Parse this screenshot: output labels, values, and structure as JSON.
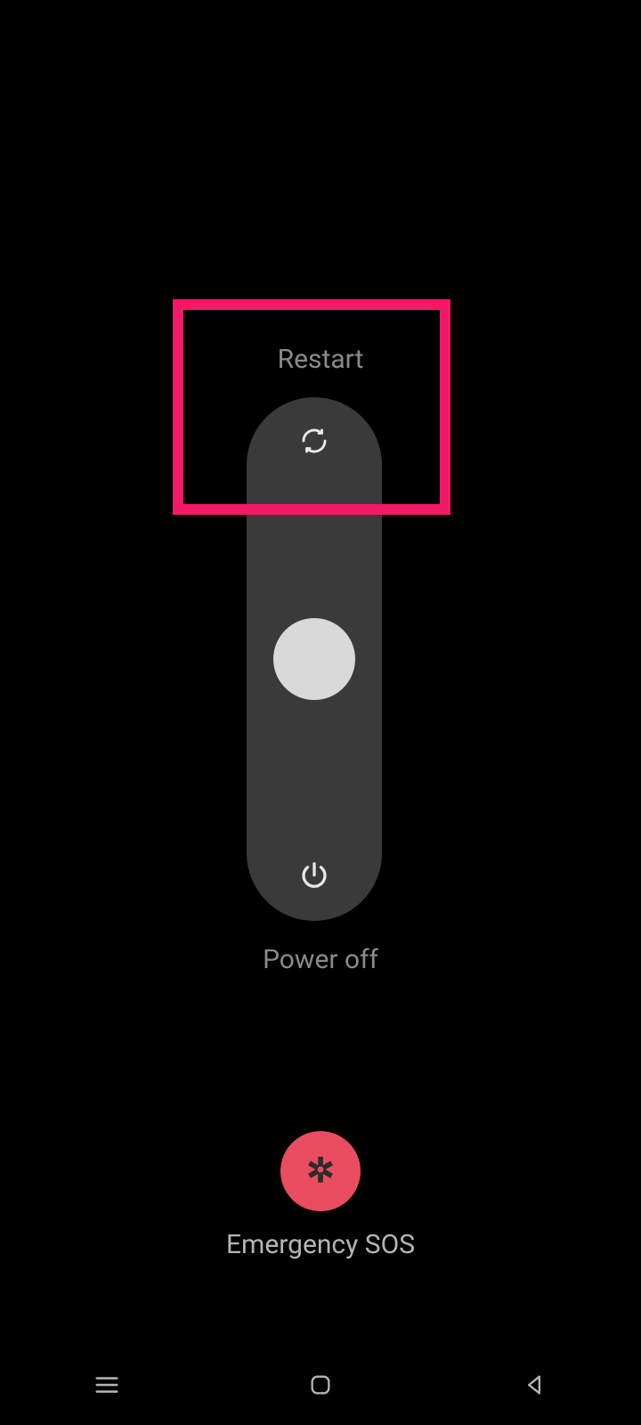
{
  "power_menu": {
    "restart_label": "Restart",
    "power_off_label": "Power off",
    "emergency_label": "Emergency SOS",
    "emergency_icon_glyph": "✲"
  },
  "colors": {
    "accent_highlight": "#f21a66",
    "emergency_button": "#ea4d60",
    "track": "#3a3a3a",
    "knob": "#d9d9d9"
  },
  "annotation": {
    "highlight_target": "restart-region"
  }
}
